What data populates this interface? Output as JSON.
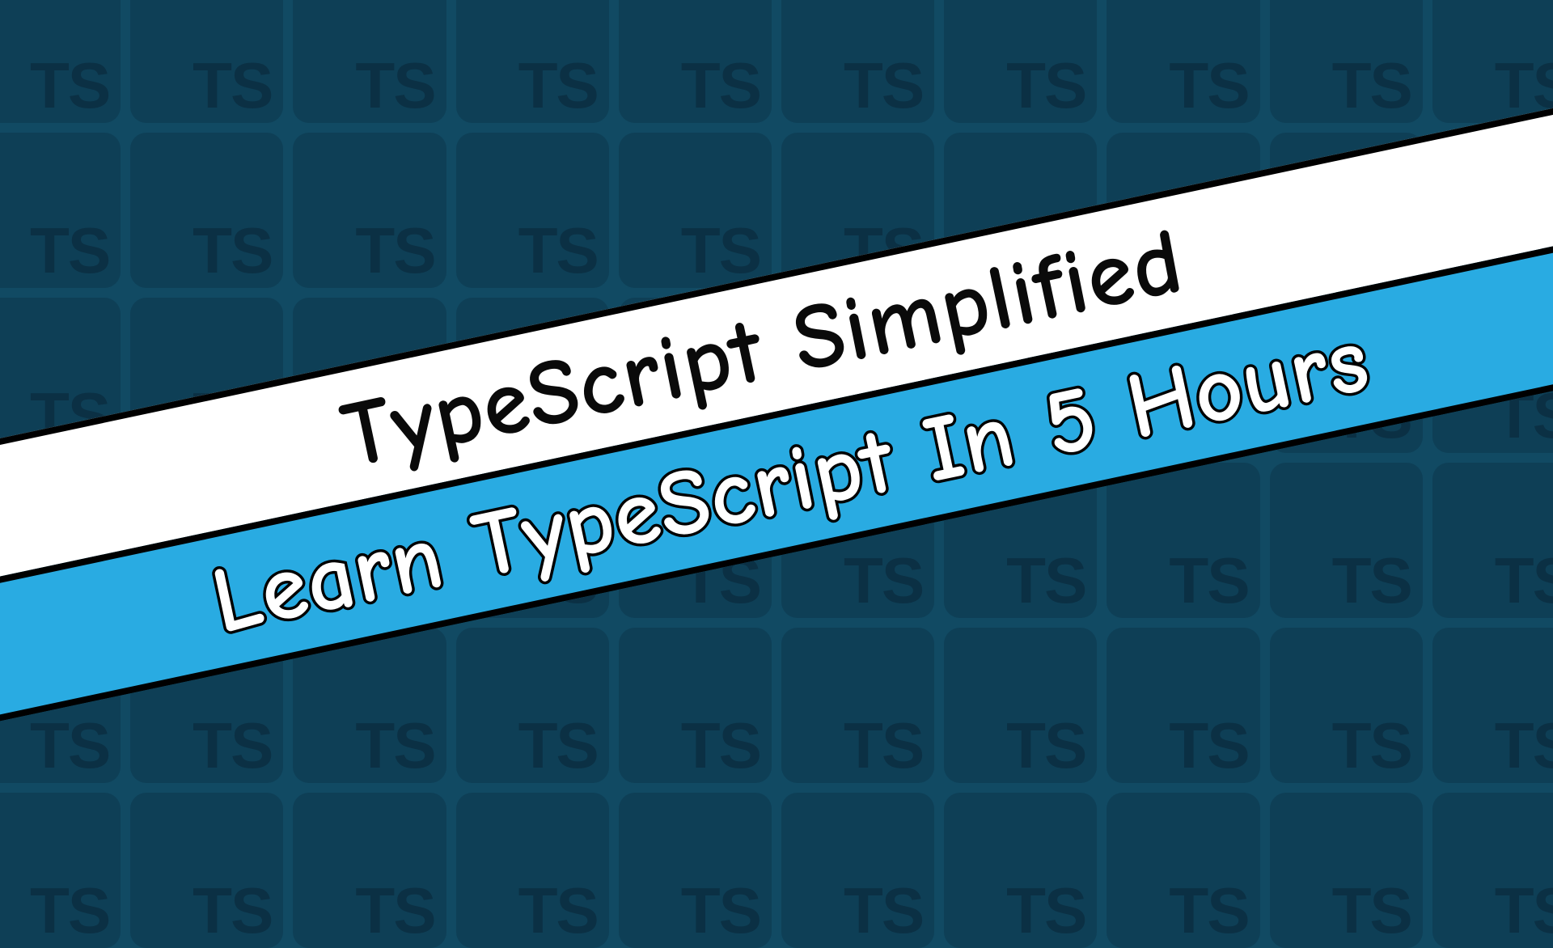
{
  "banner": {
    "title_line": "TypeScript Simplified",
    "subtitle_line": "Learn TypeScript In 5 Hours"
  },
  "background": {
    "tile_label": "TS",
    "columns": 10,
    "rows": 6
  },
  "colors": {
    "bg": "#114a63",
    "tile": "#0e3f56",
    "tile_text": "#0b3044",
    "stripe_white": "#ffffff",
    "stripe_blue": "#29abe2",
    "outline": "#000000"
  }
}
